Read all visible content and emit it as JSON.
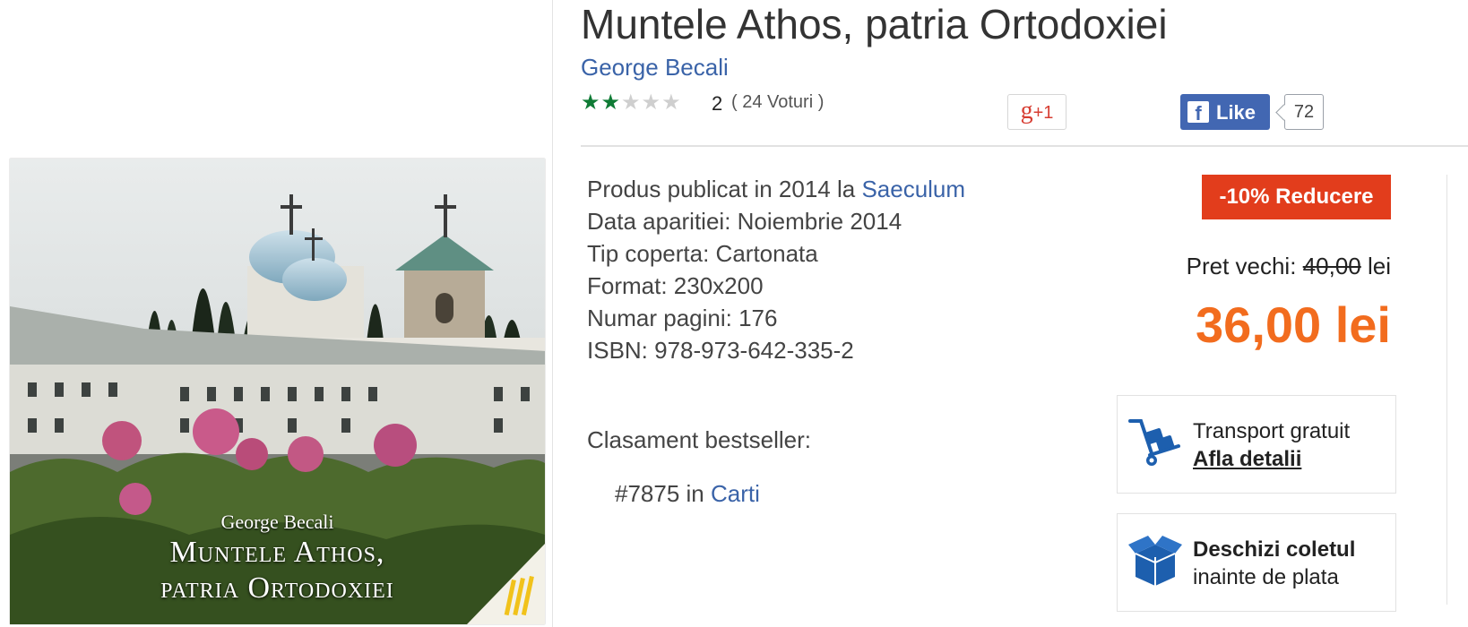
{
  "book": {
    "title": "Muntele Athos, patria Ortodoxiei",
    "author": "George Becali",
    "cover": {
      "author_text": "George Becali",
      "title_line1": "Muntele Athos,",
      "title_line2": "patria Ortodoxiei"
    }
  },
  "rating": {
    "stars_filled": 2,
    "stars_total": 5,
    "value": "2",
    "votes": "( 24 Voturi )",
    "star_color": "#0f7b35"
  },
  "social": {
    "gplus_label": "g",
    "gplus_suffix": "+1",
    "fb_logo": "f",
    "fb_like_label": "Like",
    "fb_count": "72"
  },
  "details": {
    "published_prefix": "Produs publicat in 2014 la ",
    "publisher": "Saeculum",
    "release_date": "Data aparitiei: Noiembrie 2014",
    "cover_type": "Tip coperta: Cartonata",
    "format": "Format: 230x200",
    "pages": "Numar pagini: 176",
    "isbn": "ISBN: 978-973-642-335-2"
  },
  "bestseller": {
    "label": "Clasament bestseller:",
    "rank_prefix": "#7875 in ",
    "category": "Carti"
  },
  "pricing": {
    "discount_badge": "-10% Reducere",
    "old_price_label": "Pret vechi: ",
    "old_price_value": "40,00",
    "old_price_currency": " lei",
    "price": "36,00 lei",
    "price_color": "#f26c1e",
    "badge_color": "#e23d1c"
  },
  "shipping": {
    "icon": "hand-truck-icon",
    "line1": "Transport gratuit",
    "link": "Afla detalii"
  },
  "open_package": {
    "icon": "open-box-icon",
    "line1": "Deschizi coletul",
    "line2": "inainte de plata"
  }
}
